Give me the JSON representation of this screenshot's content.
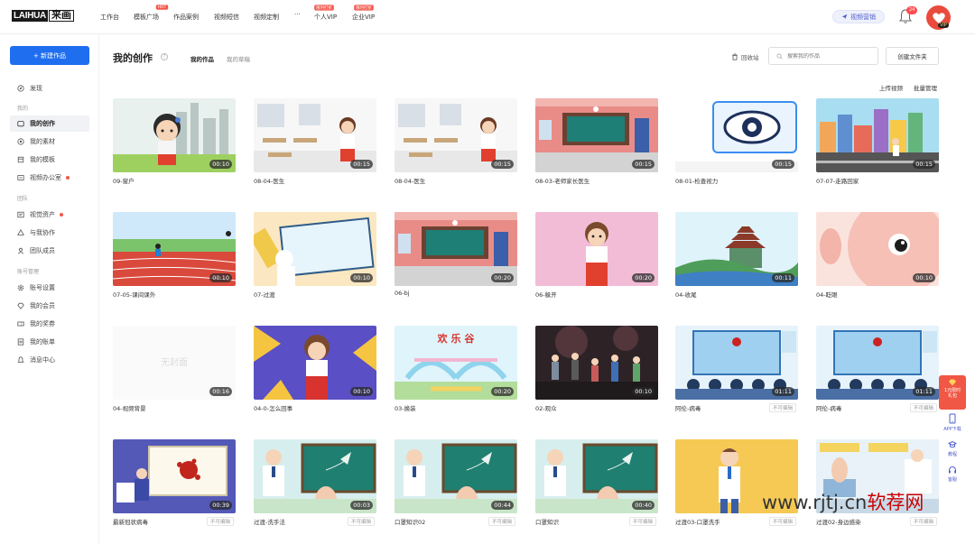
{
  "logo": {
    "latin": "LAIHUA",
    "cn": "来画"
  },
  "nav": {
    "items": [
      {
        "label": "工作台"
      },
      {
        "label": "模板广场",
        "badge": "HOT"
      },
      {
        "label": "作品案例"
      },
      {
        "label": "视频短信"
      },
      {
        "label": "视频定制"
      },
      {
        "label": "···"
      },
      {
        "label": "个人VIP",
        "badge": "限时打折"
      },
      {
        "label": "企业VIP",
        "badge": "限时打折"
      }
    ],
    "video_marketing": "视频营销",
    "notification_count": "24",
    "vip_tag": "VIP"
  },
  "sidebar": {
    "new_button": "+ 新建作品",
    "discover": "发现",
    "section_mine": "我的",
    "my_works": "我的创作",
    "my_assets": "我的素材",
    "my_templates": "我的模板",
    "video_office": "视频办公室",
    "section_team": "团队",
    "visual_assets": "视觉资产",
    "collab": "与我协作",
    "team_members": "团队成员",
    "section_account": "账号管理",
    "account_settings": "账号设置",
    "my_membership": "我的会员",
    "my_rewards": "我的奖券",
    "my_bills": "我的账单",
    "messages": "消息中心"
  },
  "header": {
    "title": "我的创作",
    "tab_works": "我的作品",
    "tab_drafts": "我的草稿",
    "trash": "回收站",
    "search_placeholder": "搜索我的作品",
    "new_folder": "创建文件夹",
    "upload_video": "上传视频",
    "batch_manage": "批量管理"
  },
  "cards": [
    {
      "name": "09-窗户",
      "duration": "00:10",
      "scene": "girl-city"
    },
    {
      "name": "08-04-医生",
      "duration": "00:15",
      "scene": "classroom-girl"
    },
    {
      "name": "08-04-医生",
      "duration": "00:15",
      "scene": "classroom-girl"
    },
    {
      "name": "08-03-老师家长医生",
      "duration": "00:15",
      "scene": "pink-room"
    },
    {
      "name": "08-01-检查视力",
      "duration": "00:15",
      "scene": "eye"
    },
    {
      "name": "07-07-走路回家",
      "duration": "00:15",
      "scene": "street"
    },
    {
      "name": "07-05-课间课外",
      "duration": "00:10",
      "scene": "track"
    },
    {
      "name": "07-过渡",
      "duration": "00:10",
      "scene": "board-hand"
    },
    {
      "name": "06-bj",
      "duration": "00:20",
      "scene": "pink-room"
    },
    {
      "name": "06-躲开",
      "duration": "00:20",
      "scene": "pink-girl"
    },
    {
      "name": "04-收尾",
      "duration": "00:11",
      "scene": "pagoda"
    },
    {
      "name": "04-眨眼",
      "duration": "00:10",
      "scene": "face"
    },
    {
      "name": "04-视频背景",
      "duration": "00:16",
      "scene": "blank",
      "blank_text": "无封面"
    },
    {
      "name": "04-0-怎么回事",
      "duration": "00:10",
      "scene": "purple-girl"
    },
    {
      "name": "03-换装",
      "duration": "00:20",
      "scene": "park",
      "park_text": "欢 乐 谷"
    },
    {
      "name": "02-观众",
      "duration": "00:10",
      "scene": "crowd"
    },
    {
      "name": "阿伦-病毒",
      "duration": "01:11",
      "scene": "lecture",
      "tag": "不可编辑"
    },
    {
      "name": "阿伦-病毒",
      "duration": "01:11",
      "scene": "lecture",
      "tag": "不可编辑"
    },
    {
      "name": "最新冠状病毒",
      "duration": "00:39",
      "scene": "virus-doctor",
      "tag": "不可编辑"
    },
    {
      "name": "过渡-洗手法",
      "duration": "00:03",
      "scene": "doctor-board",
      "tag": "不可编辑"
    },
    {
      "name": "口罩知识02",
      "duration": "00:44",
      "scene": "doctor-board",
      "tag": "不可编辑"
    },
    {
      "name": "口罩知识",
      "duration": "00:40",
      "scene": "doctor-board",
      "tag": "不可编辑"
    },
    {
      "name": "过渡03-口罩洗手",
      "duration": "",
      "scene": "doctor-yellow",
      "tag": "不可编辑"
    },
    {
      "name": "过渡02-身边感染",
      "duration": "",
      "scene": "hospital-hand",
      "tag": "不可编辑"
    }
  ],
  "promo": {
    "line1": "1元限时",
    "line2": "礼包"
  },
  "float_tools": {
    "app": "APP下载",
    "tutorial": "教程",
    "service": "客服"
  },
  "watermark": {
    "latin": "www.rjtj.cn",
    "cn": "软荐网"
  },
  "colors": {
    "accent": "#1f6ef0",
    "badge_red": "#f5564a",
    "vip_gold": "#f7d98a"
  }
}
